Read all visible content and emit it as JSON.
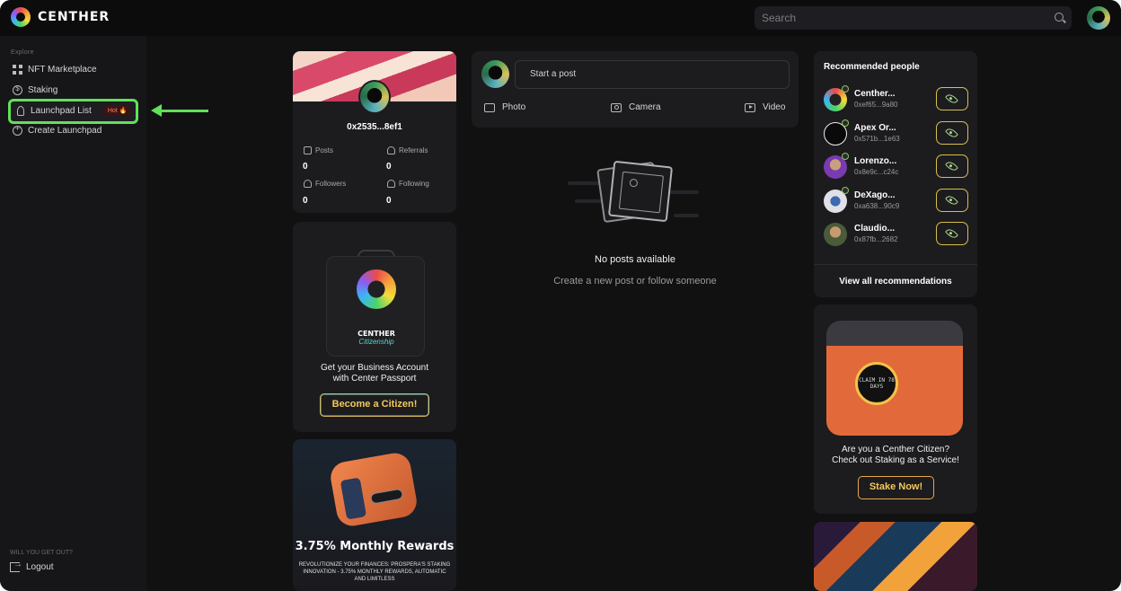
{
  "app": {
    "name": "CENTHER",
    "brand_color": "#62e05a"
  },
  "search": {
    "placeholder": "Search"
  },
  "sidebar": {
    "section_label": "Explore",
    "items": [
      {
        "label": "NFT Marketplace",
        "icon": "grid-icon"
      },
      {
        "label": "Staking",
        "icon": "dollar-icon"
      },
      {
        "label": "Launchpad List",
        "icon": "rocket-icon",
        "badge": "Hot 🔥",
        "active": true
      },
      {
        "label": "Create Launchpad",
        "icon": "plus-circle-icon"
      }
    ],
    "bottom_label": "WILL YOU GET OUT?",
    "logout_label": "Logout"
  },
  "profile": {
    "address": "0x2535...8ef1",
    "stats": [
      {
        "label": "Posts",
        "value": "0"
      },
      {
        "label": "Referrals",
        "value": "0"
      },
      {
        "label": "Followers",
        "value": "0"
      },
      {
        "label": "Following",
        "value": "0"
      }
    ]
  },
  "promo": {
    "passport_title": "CENTHER",
    "passport_sub": "Citizenship",
    "line1": "Get your Business Account",
    "line2": "with Center Passport",
    "button": "Become a Citizen!"
  },
  "staking_promo": {
    "title": "3.75% Monthly Rewards",
    "subtitle": "REVOLUTIONIZE YOUR FINANCES: PROSPERA'S STAKING INNOVATION - 3.75% MONTHLY REWARDS, AUTOMATIC AND LIMITLESS"
  },
  "composer": {
    "placeholder": "Start a post",
    "actions": [
      {
        "label": "Photo",
        "icon": "photo-icon"
      },
      {
        "label": "Camera",
        "icon": "camera-icon"
      },
      {
        "label": "Video",
        "icon": "video-icon"
      }
    ]
  },
  "empty_state": {
    "title": "No posts available",
    "subtitle": "Create a new post or follow someone"
  },
  "recommended": {
    "title": "Recommended people",
    "people": [
      {
        "name": "Centher...",
        "address": "0xef65...9a80"
      },
      {
        "name": "Apex Or...",
        "address": "0x571b...1e63"
      },
      {
        "name": "Lorenzo...",
        "address": "0x8e9c...c24c"
      },
      {
        "name": "DeXago...",
        "address": "0xa638...90c9"
      },
      {
        "name": "Claudio...",
        "address": "0x87fb...2682"
      }
    ],
    "view_all": "View all recommendations"
  },
  "citizen_promo": {
    "device_text": "CLAIM IN 78 DAYS",
    "line1": "Are you a Centher Citizen?",
    "line2": "Check out Staking as a Service!",
    "button": "Stake Now!"
  }
}
